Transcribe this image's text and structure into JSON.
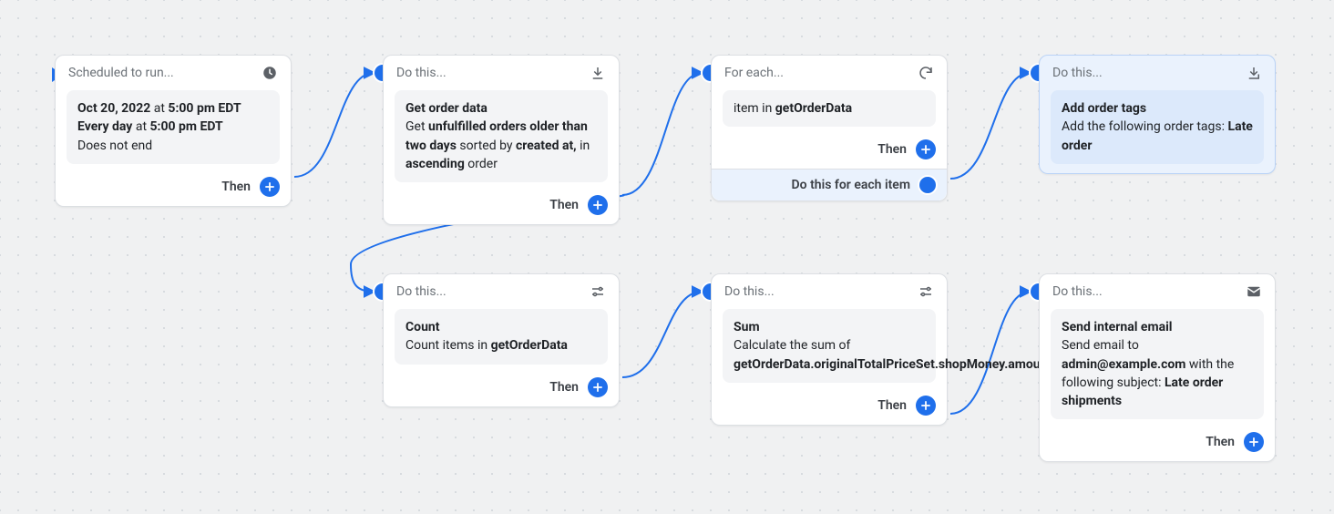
{
  "then_label": "Then",
  "cards": {
    "trigger": {
      "title": "Scheduled to run...",
      "date": "Oct 20, 2022",
      "at1": " at ",
      "time1": "5:00 pm EDT",
      "repeat": "Every day",
      "at2": " at ",
      "time2": "5:00 pm EDT",
      "noend": "Does not end"
    },
    "getdata": {
      "title": "Do this...",
      "h": "Get order data",
      "l1a": "Get ",
      "l1b": "unfulfilled orders older than two days",
      "l2a": " sorted by ",
      "l2b": "created at,",
      "l2c": " in ",
      "l3a": "ascending",
      "l3b": " order"
    },
    "foreach": {
      "title": "For each...",
      "item_prefix": "item in ",
      "item_var": "getOrderData",
      "footer": "Do this for each item"
    },
    "addtags": {
      "title": "Do this...",
      "h": "Add order tags",
      "l1": "Add the following order tags: ",
      "tag": "Late order"
    },
    "count": {
      "title": "Do this...",
      "h": "Count",
      "l1": "Count items in ",
      "var": "getOrderData"
    },
    "sum": {
      "title": "Do this...",
      "h": "Sum",
      "l1": "Calculate the sum of ",
      "var": "getOrderData.originalTotalPriceSet.shopMoney.amount"
    },
    "email": {
      "title": "Do this...",
      "h": "Send internal email",
      "l1": "Send email to ",
      "addr": "admin@example.com",
      "l2": " with the following subject: ",
      "subj": "Late order shipments"
    }
  }
}
